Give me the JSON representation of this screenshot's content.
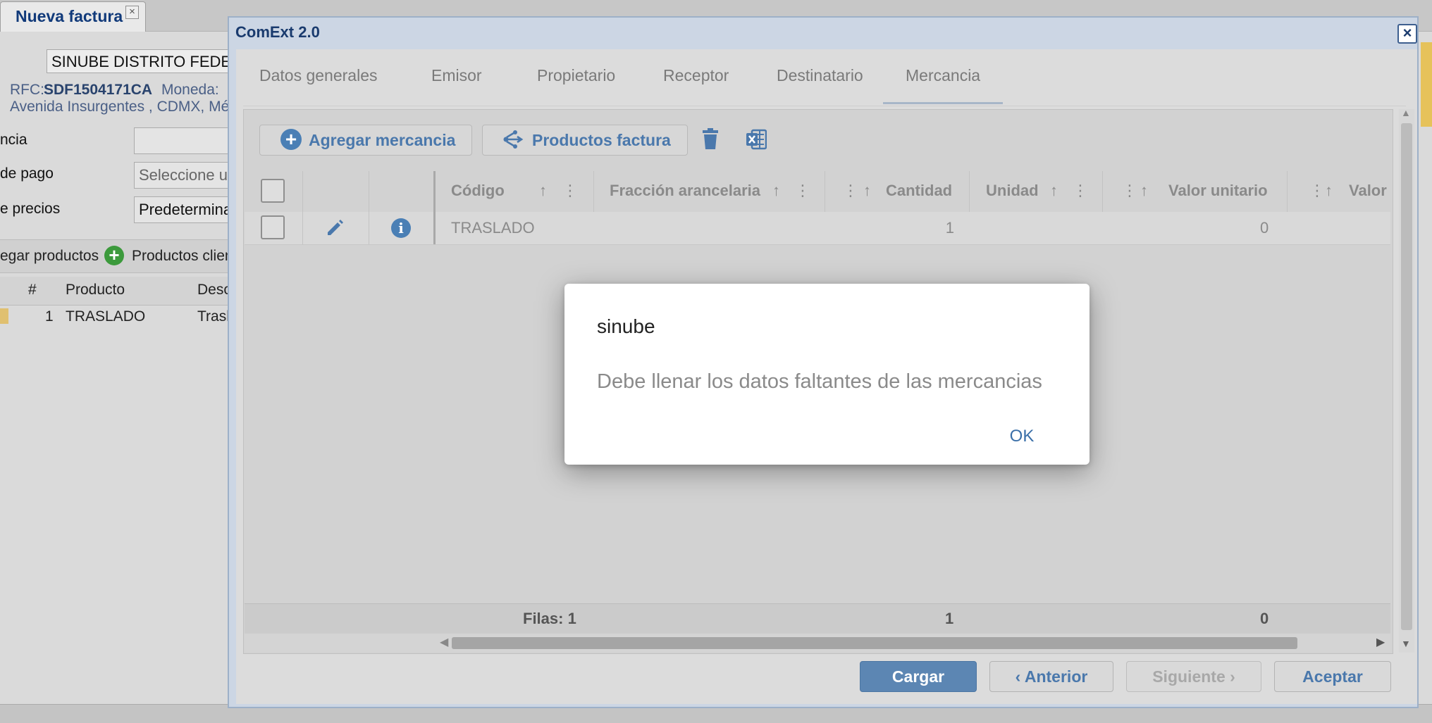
{
  "background": {
    "tab_label": "Nueva factura",
    "tab_close": "×",
    "company_name": "SINUBE DISTRITO FEDERAL",
    "rfc_label": "RFC:",
    "rfc_value": "SDF1504171CA",
    "moneda_label": "Moneda:",
    "address": "Avenida Insurgentes , CDMX, México",
    "field_labels": [
      "ncia",
      "de pago",
      "e precios"
    ],
    "field_values": [
      "",
      "Seleccione un",
      "Predeterminado"
    ],
    "toolbar": [
      "egar productos",
      "Productos clientes"
    ],
    "grid_headers": [
      "#",
      "Producto",
      "Descripción"
    ],
    "grid_row": [
      "1",
      "TRASLADO",
      "Traslado"
    ]
  },
  "window": {
    "title": "ComExt 2.0",
    "close": "×",
    "tabs": [
      "Datos generales",
      "Emisor",
      "Propietario",
      "Receptor",
      "Destinatario",
      "Mercancia"
    ],
    "active_tab": "Mercancia"
  },
  "toolbar": {
    "add_label": "Agregar mercancia",
    "products_label": "Productos factura",
    "add_glyph": "+"
  },
  "grid": {
    "headers": {
      "codigo": "Código",
      "fraccion": "Fracción arancelaria",
      "cantidad": "Cantidad",
      "unidad": "Unidad",
      "valor_unitario": "Valor unitario",
      "valor": "Valor"
    },
    "rows": [
      {
        "codigo": "TRASLADO",
        "cantidad": "1",
        "valor_unitario": "0"
      }
    ],
    "footer": {
      "filas": "Filas: 1",
      "cantidad_total": "1",
      "valor_total": "0"
    },
    "info_glyph": "i",
    "sort_glyph": "↑",
    "menu_glyph": "⋮"
  },
  "buttons": {
    "cargar": "Cargar",
    "anterior": "‹ Anterior",
    "siguiente": "Siguiente ›",
    "aceptar": "Aceptar"
  },
  "alert": {
    "title": "sinube",
    "message": "Debe llenar los datos faltantes de las mercancias",
    "ok": "OK"
  },
  "colors": {
    "accent": "#4a78ac",
    "primary_button": "#5c86b3",
    "window_title": "#1a3b6e"
  }
}
